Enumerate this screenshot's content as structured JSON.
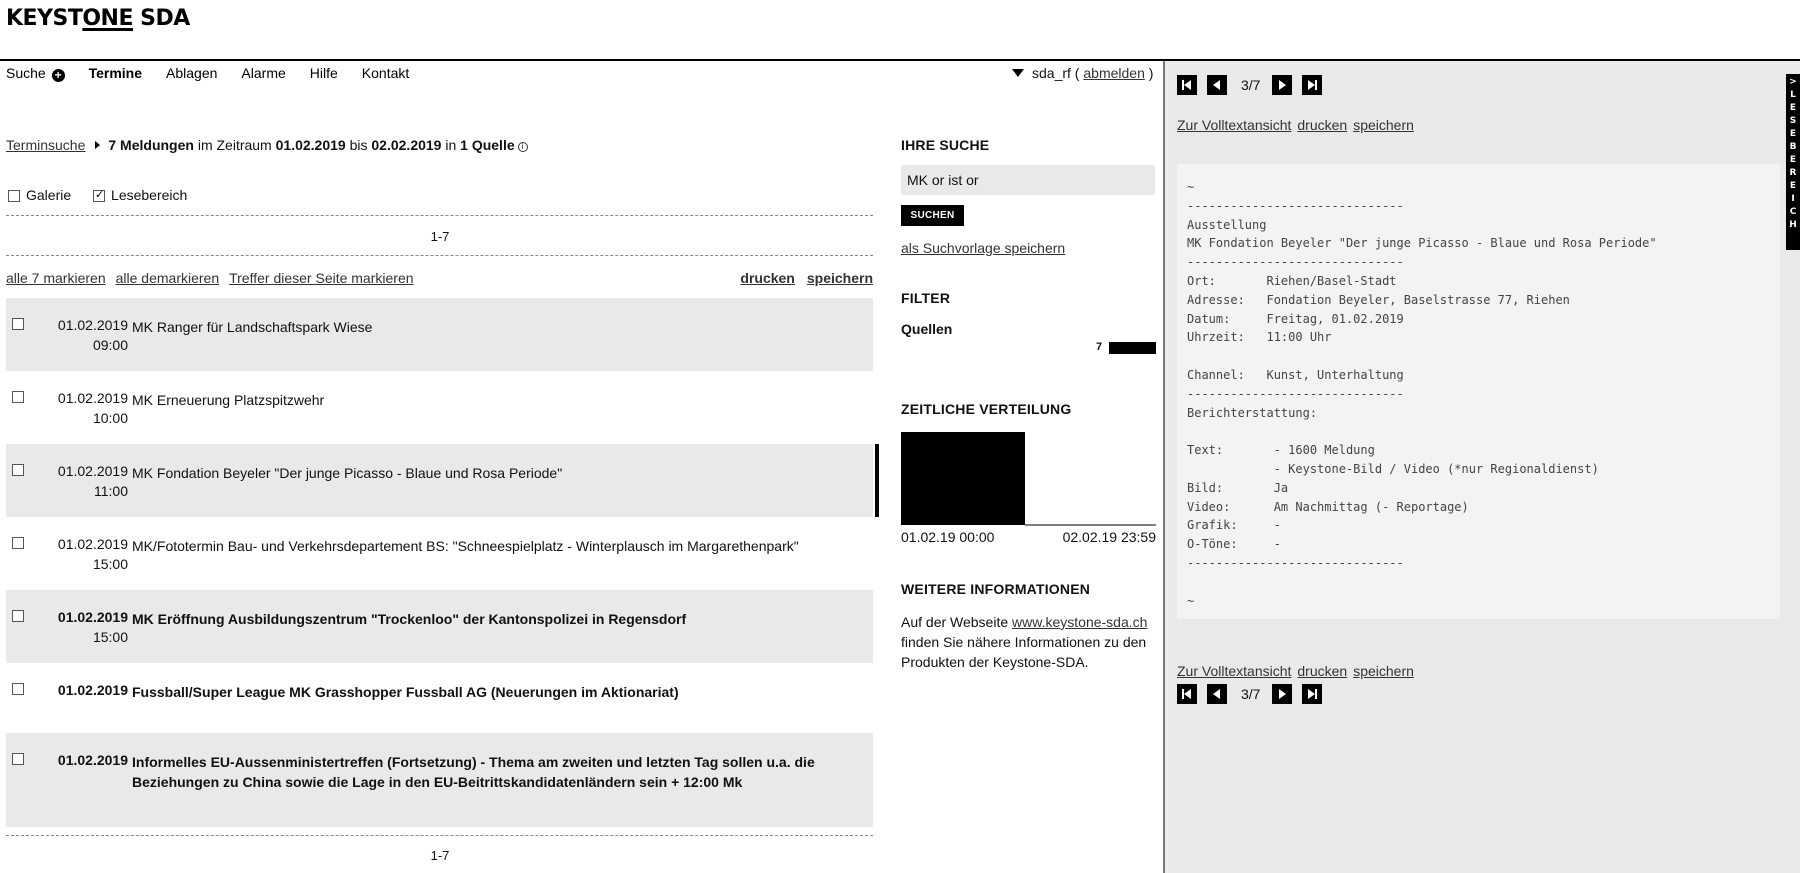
{
  "header": {
    "logo_a": "KEYST",
    "logo_one": "ONE",
    "logo_b": " SDA"
  },
  "nav": {
    "items": [
      {
        "label": "Suche",
        "icon": "plus-circle-icon"
      },
      {
        "label": "Termine",
        "active": true
      },
      {
        "label": "Ablagen"
      },
      {
        "label": "Alarme"
      },
      {
        "label": "Hilfe"
      },
      {
        "label": "Kontakt"
      }
    ],
    "user": "sda_rf",
    "paren_open": " ( ",
    "logout": "abmelden",
    "paren_close": " )"
  },
  "breadcrumb": {
    "link": "Terminsuche",
    "count": "7 Meldungen",
    "t1": " im Zeitraum ",
    "from": "01.02.2019",
    "t2": " bis ",
    "to": "02.02.2019",
    "t3": " in ",
    "sources": "1 Quelle",
    "info_glyph": "i"
  },
  "view_options": {
    "gallery": "Galerie",
    "reading": "Lesebereich"
  },
  "pager": "1-7",
  "actions": {
    "mark_all": "alle 7 markieren",
    "unmark_all": "alle demarkieren",
    "mark_page": "Treffer dieser Seite markieren",
    "print": "drucken",
    "save": "speichern"
  },
  "results": [
    {
      "date": "01.02.2019",
      "time": "09:00",
      "title": "MK Ranger für Landschaftspark Wiese",
      "bold": false
    },
    {
      "date": "01.02.2019",
      "time": "10:00",
      "title": "MK Erneuerung Platzspitzwehr",
      "bold": false
    },
    {
      "date": "01.02.2019",
      "time": "11:00",
      "title": "MK Fondation Beyeler \"Der junge Picasso - Blaue und Rosa Periode\"",
      "bold": false,
      "selected": true
    },
    {
      "date": "01.02.2019",
      "time": "15:00",
      "title": "MK/Fototermin Bau- und Verkehrsdepartement BS: \"Schneespielplatz - Winterplausch im Margarethenpark\"",
      "bold": false
    },
    {
      "date": "01.02.2019",
      "time": "15:00",
      "title": "MK Eröffnung Ausbildungszentrum \"Trockenloo\" der Kantonspolizei in Regensdorf",
      "bold": true
    },
    {
      "date": "01.02.2019",
      "time": "",
      "title": "Fussball/Super League MK Grasshopper Fussball AG (Neuerungen im Aktionariat)",
      "bold": true
    },
    {
      "date": "01.02.2019",
      "time": "",
      "title": "Informelles EU-Aussenministertreffen (Fortsetzung) - Thema am zweiten und letzten Tag sollen u.a. die Beziehungen zu China sowie die Lage in den EU-Beitrittskandidatenländern sein + 12:00 Mk",
      "bold": true
    }
  ],
  "sidebar": {
    "your_search": "IHRE SUCHE",
    "query": "MK or ist or",
    "search_btn": "SUCHEN",
    "save_template": "als Suchvorlage speichern",
    "filter": "FILTER",
    "sources": "Quellen",
    "source_count": "7",
    "dist_head": "ZEITLICHE VERTEILUNG",
    "dist_start": "01.02.19 00:00",
    "dist_end": "02.02.19 23:59",
    "more_head": "WEITERE INFORMATIONEN",
    "more_1": "Auf der Webseite ",
    "more_link": "www.keystone-sda.ch",
    "more_2": " finden Sie nähere Informationen zu den Produkten der Keystone-SDA."
  },
  "reader": {
    "counter": "3/7",
    "fulltext": "Zur Volltextansicht",
    "print": "drucken",
    "save": "speichern",
    "tab_label": ">LESEBEREICH",
    "document": "~\n------------------------------\nAusstellung\nMK Fondation Beyeler \"Der junge Picasso - Blaue und Rosa Periode\"\n------------------------------\nOrt:       Riehen/Basel-Stadt\nAdresse:   Fondation Beyeler, Baselstrasse 77, Riehen\nDatum:     Freitag, 01.02.2019\nUhrzeit:   11:00 Uhr\n\nChannel:   Kunst, Unterhaltung\n------------------------------\nBerichterstattung:\n\nText:       - 1600 Meldung\n            - Keystone-Bild / Video (*nur Regionaldienst)\nBild:       Ja\nVideo:      Am Nachmittag (- Reportage)\nGrafik:     -\nO-Töne:     -\n------------------------------\n\n~"
  }
}
